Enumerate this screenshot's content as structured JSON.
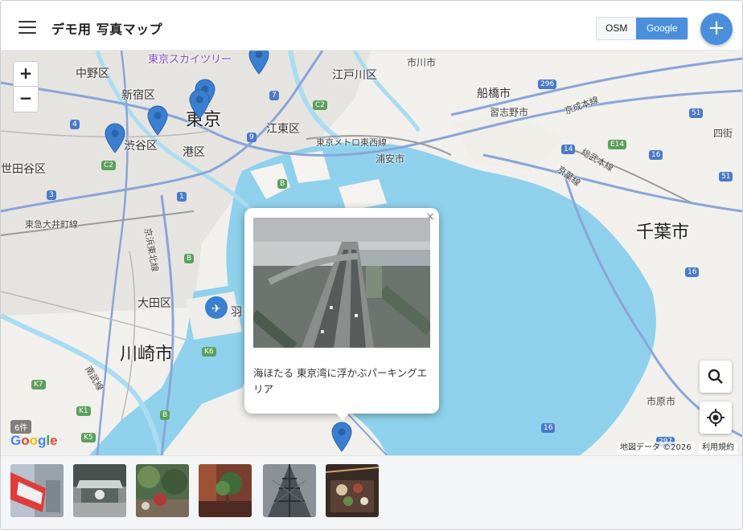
{
  "header": {
    "title": "デモ用 写真マップ",
    "toggle_osm": "OSM",
    "toggle_google": "Google",
    "add_label": "+"
  },
  "map": {
    "zoom_in": "+",
    "zoom_out": "−",
    "labels": {
      "nakano": "中野区",
      "shinjuku": "新宿区",
      "shibuya": "渋谷区",
      "minato": "港区",
      "tokyo": "東京",
      "skytree": "東京スカイツリー",
      "edogawa": "江戸川区",
      "koto": "江東区",
      "ichikawa": "市川市",
      "funabashi": "船橋市",
      "narashino": "習志野市",
      "urayasu": "浦安市",
      "setagaya": "世田谷区",
      "ota": "大田区",
      "kawasaki": "川崎市",
      "chiba": "千葉市",
      "ichihara": "市原市",
      "yotsukaido": "四街",
      "haneda": "羽",
      "keiyo": "京葉線",
      "tozai": "東京メトロ東西線",
      "toyoko": "東急大井町線",
      "keihin": "京浜東北線",
      "nanbu": "南武線",
      "sobu": "総武本線",
      "keisei": "京成本線"
    },
    "road_badges": [
      "296",
      "7",
      "C2",
      "4",
      "9",
      "14",
      "E14",
      "16",
      "C2",
      "3",
      "1",
      "B",
      "B",
      "K6",
      "K7",
      "K1",
      "K5",
      "B",
      "16",
      "51",
      "51",
      "297",
      "16"
    ],
    "popup": {
      "close": "×",
      "caption": "海ほたる 東京湾に浮かぶパーキングエリア"
    },
    "count_badge": "6件",
    "google_logo": "Google",
    "attribution": "地図データ ©2026",
    "terms": "利用規約",
    "search_icon": "search-icon",
    "locate_icon": "locate-icon"
  },
  "thumbnails": [
    {
      "name": "thumb-flag"
    },
    {
      "name": "thumb-plaza"
    },
    {
      "name": "thumb-garden"
    },
    {
      "name": "thumb-bonsai"
    },
    {
      "name": "thumb-tower"
    },
    {
      "name": "thumb-food"
    }
  ],
  "colors": {
    "accent": "#4a8fdc",
    "water": "#8fd1ec",
    "marker": "#3b7fd0"
  }
}
